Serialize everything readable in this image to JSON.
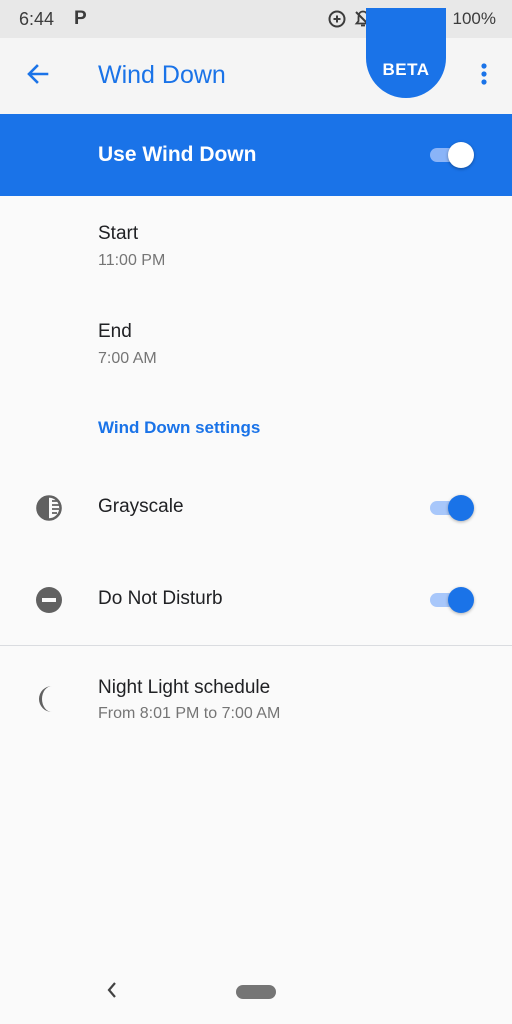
{
  "status_bar": {
    "time": "6:44",
    "notification_letter": "P",
    "battery_percent": "100%",
    "icons": [
      "data-saver-icon",
      "notifications-off-icon",
      "wifi-icon",
      "airplane-mode-icon",
      "battery-icon"
    ]
  },
  "app_bar": {
    "title": "Wind Down",
    "badge": "BETA",
    "back_icon": "arrow-back-icon",
    "more_icon": "more-vert-icon"
  },
  "master_switch": {
    "label": "Use Wind Down",
    "checked": true
  },
  "schedule": {
    "start": {
      "title": "Start",
      "summary": "11:00 PM"
    },
    "end": {
      "title": "End",
      "summary": "7:00 AM"
    }
  },
  "settings_section": {
    "header": "Wind Down settings",
    "items": [
      {
        "title": "Grayscale",
        "icon": "grayscale-icon",
        "checked": true
      },
      {
        "title": "Do Not Disturb",
        "icon": "do-not-disturb-icon",
        "checked": true
      }
    ]
  },
  "night_light": {
    "title": "Night Light schedule",
    "summary": "From 8:01 PM to 7:00 AM",
    "icon": "night-light-icon"
  },
  "colors": {
    "accent": "#1a73e8",
    "switch_track_on": "#a8c7fa",
    "text_primary": "#202124",
    "text_secondary": "#757575",
    "status_bar_bg": "#e8e8e8"
  }
}
